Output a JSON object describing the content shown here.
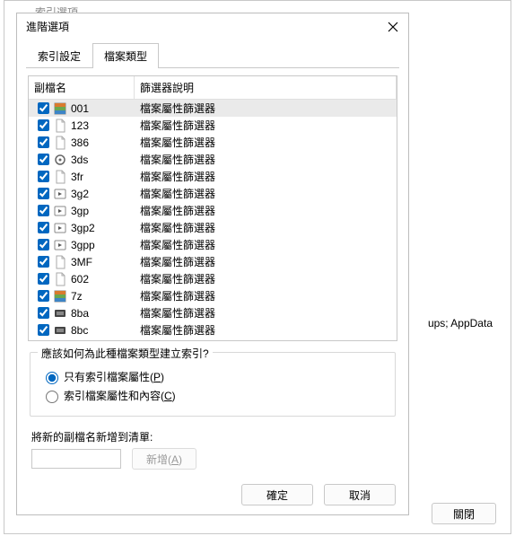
{
  "outer": {
    "title": "索引選項",
    "close_btn": "關閉",
    "side_text": "ups; AppData"
  },
  "inner": {
    "title": "進階選項",
    "tabs": {
      "tab1": "索引設定",
      "tab2": "檔案類型"
    },
    "list_headers": {
      "ext": "副檔名",
      "desc": "篩選器說明"
    },
    "group": {
      "title": "應該如何為此種檔案類型建立索引?",
      "opt1_pre": "只有索引檔案屬性(",
      "opt1_key": "P",
      "opt1_post": ")",
      "opt2_pre": "索引檔案屬性和內容(",
      "opt2_key": "C",
      "opt2_post": ")"
    },
    "add_label": "將新的副檔名新增到清單:",
    "add_btn_pre": "新增(",
    "add_btn_key": "A",
    "add_btn_post": ")",
    "ok": "確定",
    "cancel": "取消"
  },
  "rows": [
    {
      "ext": "001",
      "desc": "檔案屬性篩選器",
      "icon": "rar",
      "sel": true
    },
    {
      "ext": "123",
      "desc": "檔案屬性篩選器",
      "icon": "blank"
    },
    {
      "ext": "386",
      "desc": "檔案屬性篩選器",
      "icon": "blank"
    },
    {
      "ext": "3ds",
      "desc": "檔案屬性篩選器",
      "icon": "gear"
    },
    {
      "ext": "3fr",
      "desc": "檔案屬性篩選器",
      "icon": "blank"
    },
    {
      "ext": "3g2",
      "desc": "檔案屬性篩選器",
      "icon": "media"
    },
    {
      "ext": "3gp",
      "desc": "檔案屬性篩選器",
      "icon": "media"
    },
    {
      "ext": "3gp2",
      "desc": "檔案屬性篩選器",
      "icon": "media"
    },
    {
      "ext": "3gpp",
      "desc": "檔案屬性篩選器",
      "icon": "media"
    },
    {
      "ext": "3MF",
      "desc": "檔案屬性篩選器",
      "icon": "blank"
    },
    {
      "ext": "602",
      "desc": "檔案屬性篩選器",
      "icon": "blank"
    },
    {
      "ext": "7z",
      "desc": "檔案屬性篩選器",
      "icon": "rar"
    },
    {
      "ext": "8ba",
      "desc": "檔案屬性篩選器",
      "icon": "plugin"
    },
    {
      "ext": "8bc",
      "desc": "檔案屬性篩選器",
      "icon": "plugin"
    }
  ]
}
